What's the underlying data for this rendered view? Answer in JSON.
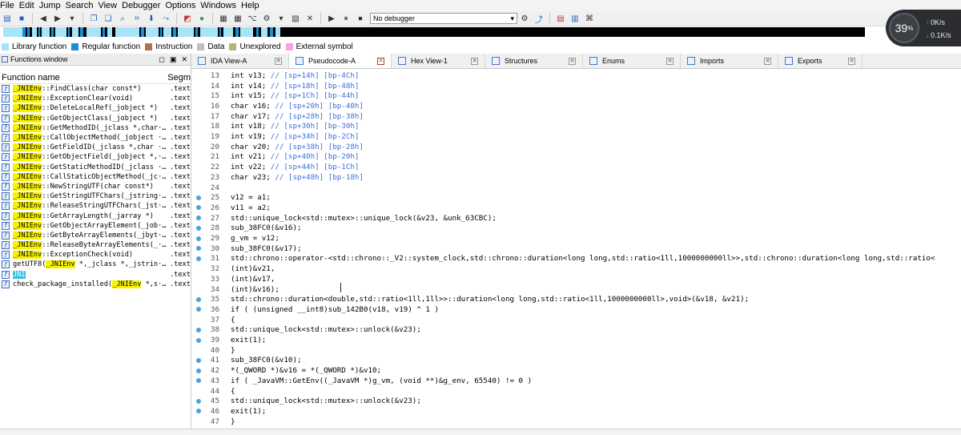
{
  "menubar": {
    "items": [
      "File",
      "Edit",
      "Jump",
      "Search",
      "View",
      "Debugger",
      "Options",
      "Windows",
      "Help"
    ]
  },
  "toolbar": {
    "debugger_select": "No debugger"
  },
  "legend": [
    {
      "label": "Library function",
      "color": "#a8e4f7"
    },
    {
      "label": "Regular function",
      "color": "#1a8fd6"
    },
    {
      "label": "Instruction",
      "color": "#b86f50"
    },
    {
      "label": "Data",
      "color": "#c0c0c0"
    },
    {
      "label": "Unexplored",
      "color": "#b5b37a"
    },
    {
      "label": "External symbol",
      "color": "#ff9ee3"
    }
  ],
  "perf": {
    "cpu": "39",
    "cpu_unit": "%",
    "up": "0K/s",
    "down": "0.1K/s"
  },
  "functions_window": {
    "title": "Functions window",
    "col_name": "Function name",
    "col_segment": "Segm",
    "rows": [
      {
        "prefix": "",
        "hl": "_JNIEnv",
        "rest": "::FindClass(char const*)",
        "seg": ".text"
      },
      {
        "prefix": "",
        "hl": "_JNIEnv",
        "rest": "::ExceptionClear(void)",
        "seg": ".text"
      },
      {
        "prefix": "",
        "hl": "_JNIEnv",
        "rest": "::DeleteLocalRef(_jobject *)",
        "seg": ".text"
      },
      {
        "prefix": "",
        "hl": "_JNIEnv",
        "rest": "::GetObjectClass(_jobject *)",
        "seg": ".text"
      },
      {
        "prefix": "",
        "hl": "_JNIEnv",
        "rest": "::GetMethodID(_jclass *,char···",
        "seg": ".text"
      },
      {
        "prefix": "",
        "hl": "_JNIEnv",
        "rest": "::CallObjectMethod(_jobject ···",
        "seg": ".text"
      },
      {
        "prefix": "",
        "hl": "_JNIEnv",
        "rest": "::GetFieldID(_jclass *,char ···",
        "seg": ".text"
      },
      {
        "prefix": "",
        "hl": "_JNIEnv",
        "rest": "::GetObjectField(_jobject *,···",
        "seg": ".text"
      },
      {
        "prefix": "",
        "hl": "_JNIEnv",
        "rest": "::GetStaticMethodID(_jclass ···",
        "seg": ".text"
      },
      {
        "prefix": "",
        "hl": "_JNIEnv",
        "rest": "::CallStaticObjectMethod(_jc···",
        "seg": ".text"
      },
      {
        "prefix": "",
        "hl": "_JNIEnv",
        "rest": "::NewStringUTF(char const*)",
        "seg": ".text"
      },
      {
        "prefix": "",
        "hl": "_JNIEnv",
        "rest": "::GetStringUTFChars(_jstring···",
        "seg": ".text"
      },
      {
        "prefix": "",
        "hl": "_JNIEnv",
        "rest": "::ReleaseStringUTFChars(_jst···",
        "seg": ".text"
      },
      {
        "prefix": "",
        "hl": "_JNIEnv",
        "rest": "::GetArrayLength(_jarray *)",
        "seg": ".text"
      },
      {
        "prefix": "",
        "hl": "_JNIEnv",
        "rest": "::GetObjectArrayElement(_job···",
        "seg": ".text"
      },
      {
        "prefix": "",
        "hl": "_JNIEnv",
        "rest": "::GetByteArrayElements(_jbyt···",
        "seg": ".text"
      },
      {
        "prefix": "",
        "hl": "_JNIEnv",
        "rest": "::ReleaseByteArrayElements(_···",
        "seg": ".text"
      },
      {
        "prefix": "",
        "hl": "_JNIEnv",
        "rest": "::ExceptionCheck(void)",
        "seg": ".text"
      },
      {
        "prefix": "getUTF8(",
        "hl": "_JNIEnv",
        "rest": " *,_jclass *,_jstrin···",
        "seg": ".text"
      },
      {
        "prefix": "",
        "hl": "JNI",
        "rest": "",
        "seg": ".text",
        "selected": true
      },
      {
        "prefix": "check_package_installed(",
        "hl": "_JNIEnv",
        "rest": " *,s···",
        "seg": ".text"
      }
    ]
  },
  "tabs": [
    {
      "label": "IDA View-A",
      "active": false
    },
    {
      "label": "Pseudocode-A",
      "active": true
    },
    {
      "label": "Hex View-1",
      "active": false
    },
    {
      "label": "Structures",
      "active": false
    },
    {
      "label": "Enums",
      "active": false
    },
    {
      "label": "Imports",
      "active": false
    },
    {
      "label": "Exports",
      "active": false
    }
  ],
  "code": [
    {
      "n": "13",
      "dot": false,
      "t": "int v13; ",
      "c": "// [sp+14h] [bp-4Ch]"
    },
    {
      "n": "14",
      "dot": false,
      "t": "int v14; ",
      "c": "// [sp+18h] [bp-48h]"
    },
    {
      "n": "15",
      "dot": false,
      "t": "int v15; ",
      "c": "// [sp+1Ch] [bp-44h]"
    },
    {
      "n": "16",
      "dot": false,
      "t": "char v16; ",
      "c": "// [sp+20h] [bp-40h]"
    },
    {
      "n": "17",
      "dot": false,
      "t": "char v17; ",
      "c": "// [sp+28h] [bp-38h]"
    },
    {
      "n": "18",
      "dot": false,
      "t": "int v18; ",
      "c": "// [sp+30h] [bp-30h]"
    },
    {
      "n": "19",
      "dot": false,
      "t": "int v19; ",
      "c": "// [sp+34h] [bp-2Ch]"
    },
    {
      "n": "20",
      "dot": false,
      "t": "char v20; ",
      "c": "// [sp+38h] [bp-28h]"
    },
    {
      "n": "21",
      "dot": false,
      "t": "int v21; ",
      "c": "// [sp+40h] [bp-20h]"
    },
    {
      "n": "22",
      "dot": false,
      "t": "int v22; ",
      "c": "// [sp+44h] [bp-1Ch]"
    },
    {
      "n": "23",
      "dot": false,
      "t": "char v23; ",
      "c": "// [sp+48h] [bp-18h]"
    },
    {
      "n": "24",
      "dot": false,
      "t": "",
      "c": ""
    },
    {
      "n": "25",
      "dot": true,
      "t": "v12 = a1;",
      "c": ""
    },
    {
      "n": "26",
      "dot": true,
      "t": "v11 = a2;",
      "c": ""
    },
    {
      "n": "27",
      "dot": true,
      "t": "std::unique_lock<std::mutex>::unique_lock(&v23, &unk_63CBC);",
      "c": ""
    },
    {
      "n": "28",
      "dot": true,
      "t": "sub_38FC0(&v16);",
      "c": ""
    },
    {
      "n": "29",
      "dot": true,
      "t": "g_vm = v12;",
      "c": ""
    },
    {
      "n": "30",
      "dot": true,
      "t": "sub_38FC0(&v17);",
      "c": ""
    },
    {
      "n": "31",
      "dot": true,
      "t": "std::chrono::operator-<std::chrono::_V2::system_clock,std::chrono::duration<long long,std::ratio<1ll,1000000000ll>>,std::chrono::duration<long long,std::ratio<",
      "c": ""
    },
    {
      "n": "32",
      "dot": false,
      "t": "  (int)&v21,",
      "c": ""
    },
    {
      "n": "33",
      "dot": false,
      "t": "  (int)&v17,",
      "c": ""
    },
    {
      "n": "34",
      "dot": false,
      "t": "  (int)&v16);",
      "c": ""
    },
    {
      "n": "35",
      "dot": true,
      "t": "std::chrono::duration<double,std::ratio<1ll,1ll>>::duration<long long,std::ratio<1ll,1000000000ll>,void>(&v18, &v21);",
      "c": ""
    },
    {
      "n": "36",
      "dot": true,
      "t": "if ( (unsigned __int8)sub_142B0(v18, v19) ^ 1 )",
      "c": ""
    },
    {
      "n": "37",
      "dot": false,
      "t": "{",
      "c": ""
    },
    {
      "n": "38",
      "dot": true,
      "t": "  std::unique_lock<std::mutex>::unlock(&v23);",
      "c": ""
    },
    {
      "n": "39",
      "dot": true,
      "t": "  exit(1);",
      "c": ""
    },
    {
      "n": "40",
      "dot": false,
      "t": "}",
      "c": ""
    },
    {
      "n": "41",
      "dot": true,
      "t": "sub_38FC0(&v10);",
      "c": ""
    },
    {
      "n": "42",
      "dot": true,
      "t": "*(_QWORD *)&v16 = *(_QWORD *)&v10;",
      "c": ""
    },
    {
      "n": "43",
      "dot": true,
      "t": "if ( _JavaVM::GetEnv((_JavaVM *)g_vm, (void **)&g_env, 65540) != 0 )",
      "c": ""
    },
    {
      "n": "44",
      "dot": false,
      "t": "{",
      "c": ""
    },
    {
      "n": "45",
      "dot": true,
      "t": "  std::unique_lock<std::mutex>::unlock(&v23);",
      "c": ""
    },
    {
      "n": "46",
      "dot": true,
      "t": "  exit(1);",
      "c": ""
    },
    {
      "n": "47",
      "dot": false,
      "t": "}",
      "c": ""
    }
  ]
}
